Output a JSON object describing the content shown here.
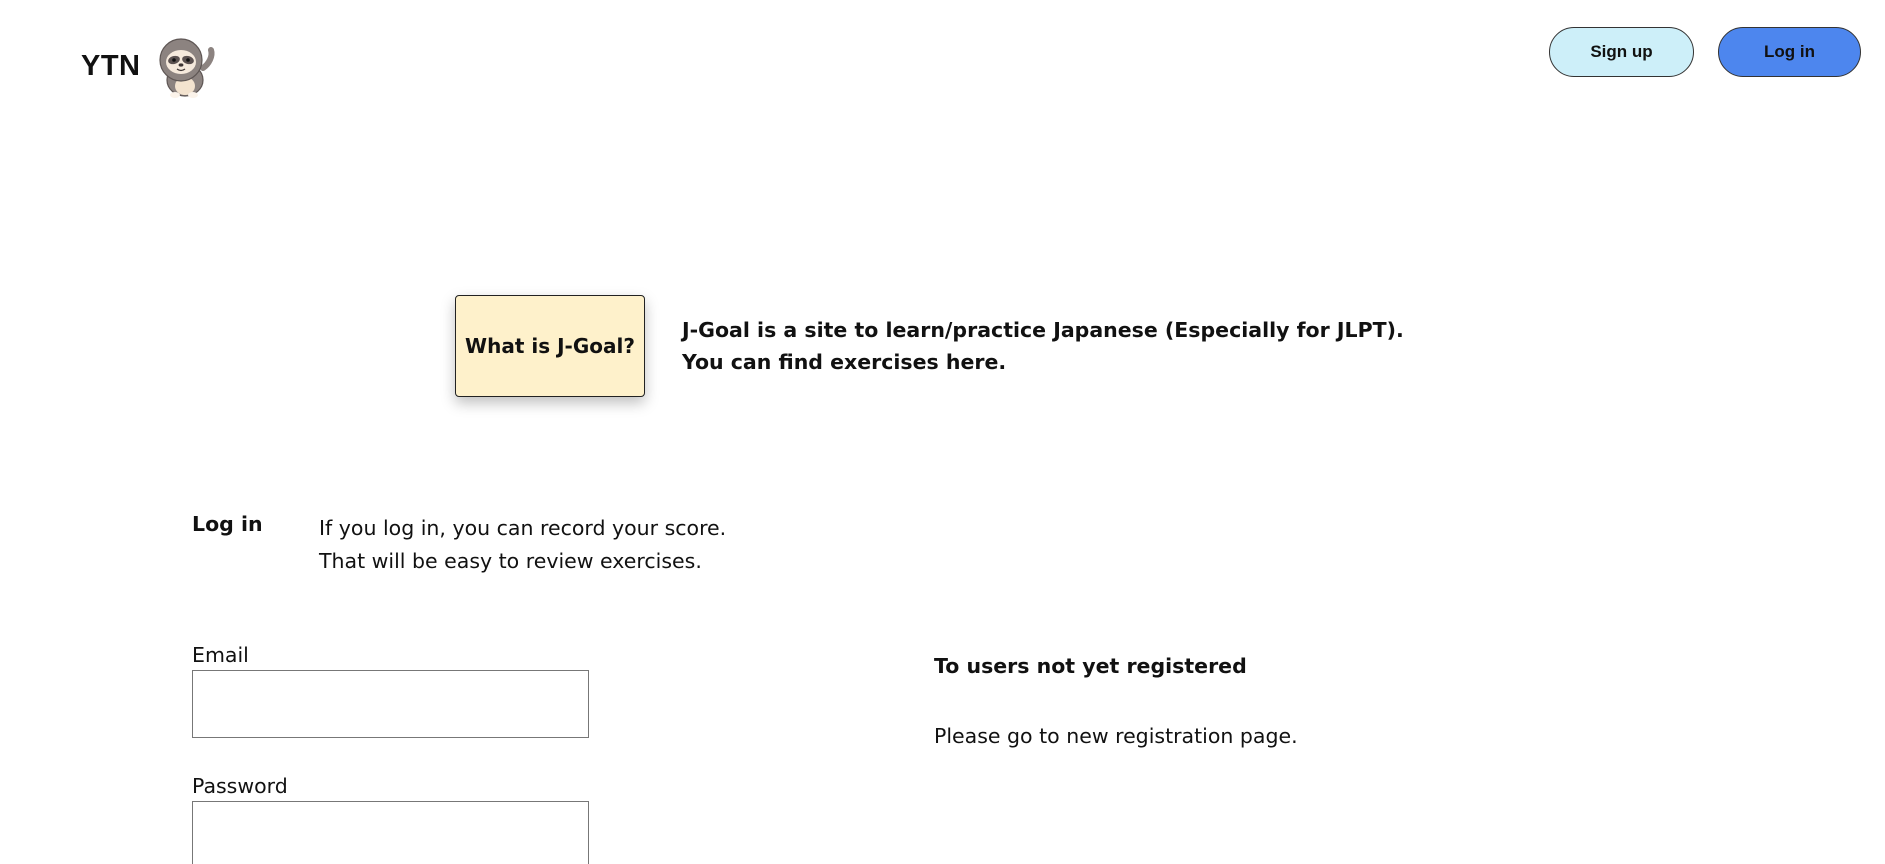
{
  "header": {
    "logo_text": "YTN",
    "mascot_icon": "sloth-mascot-icon",
    "signup_label": "Sign up",
    "login_label": "Log in",
    "colors": {
      "signup_bg": "#cdeff9",
      "login_bg": "#4d86ee"
    }
  },
  "intro": {
    "button_label": "What is J-Goal?",
    "lines": [
      "J-Goal is a site to learn/practice Japanese (Especially for JLPT).",
      "You can find exercises here."
    ],
    "box_color": "#fef1cb"
  },
  "login_section": {
    "heading": "Log in",
    "description": [
      "If you log in, you can record your score.",
      "That will be easy to review exercises."
    ],
    "email_label": "Email",
    "email_value": "",
    "password_label": "Password",
    "password_value": ""
  },
  "registration": {
    "heading": "To users not yet registered",
    "text": "Please go to new registration page."
  }
}
